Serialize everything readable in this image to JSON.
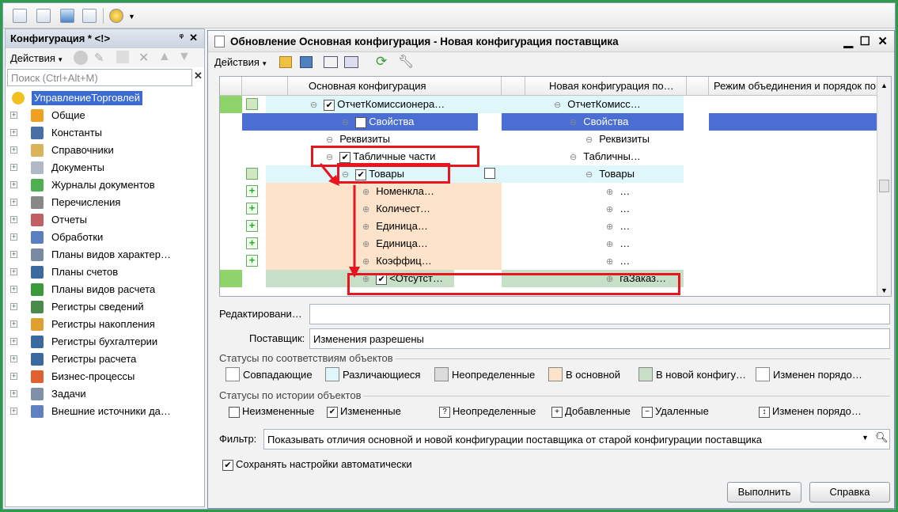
{
  "panel": {
    "title": "Конфигурация * <!>",
    "actions": "Действия",
    "search_placeholder": "Поиск (Ctrl+Alt+M)",
    "tree": [
      {
        "label": "УправлениеТорговлей",
        "icon": "config-icon",
        "selected": true,
        "color": "#f0c020"
      },
      {
        "label": "Общие",
        "icon": "common-icon",
        "color": "#f0a020"
      },
      {
        "label": "Константы",
        "icon": "constants-icon",
        "color": "#4a6fa5"
      },
      {
        "label": "Справочники",
        "icon": "catalogs-icon",
        "color": "#d9b45a"
      },
      {
        "label": "Документы",
        "icon": "documents-icon",
        "color": "#b0b8c4"
      },
      {
        "label": "Журналы документов",
        "icon": "journals-icon",
        "color": "#4caf50"
      },
      {
        "label": "Перечисления",
        "icon": "enums-icon",
        "color": "#888888"
      },
      {
        "label": "Отчеты",
        "icon": "reports-icon",
        "color": "#c06060"
      },
      {
        "label": "Обработки",
        "icon": "processing-icon",
        "color": "#5a7fc0"
      },
      {
        "label": "Планы видов характер…",
        "icon": "chart-types-icon",
        "color": "#7a8aa0"
      },
      {
        "label": "Планы счетов",
        "icon": "accounts-icon",
        "color": "#3a6aa0"
      },
      {
        "label": "Планы видов расчета",
        "icon": "calc-types-icon",
        "color": "#3a9a3a"
      },
      {
        "label": "Регистры сведений",
        "icon": "info-reg-icon",
        "color": "#4a8a4a"
      },
      {
        "label": "Регистры накопления",
        "icon": "accum-reg-icon",
        "color": "#e0a030"
      },
      {
        "label": "Регистры бухгалтерии",
        "icon": "acc-reg-icon",
        "color": "#3a6aa0"
      },
      {
        "label": "Регистры расчета",
        "icon": "calc-reg-icon",
        "color": "#3a6aa0"
      },
      {
        "label": "Бизнес-процессы",
        "icon": "bp-icon",
        "color": "#e06030"
      },
      {
        "label": "Задачи",
        "icon": "tasks-icon",
        "color": "#8090a8"
      },
      {
        "label": "Внешние источники да…",
        "icon": "ext-icon",
        "color": "#6080c0"
      }
    ]
  },
  "window": {
    "title": "Обновление Основная конфигурация - Новая конфигурация поставщика",
    "actions": "Действия",
    "columns": [
      "Основная конфигурация",
      "Новая конфигурация по…",
      "Режим объединения и порядок по…"
    ],
    "rows": [
      {
        "left": "ОтчетКомиссионера…",
        "right": "ОтчетКомисс…",
        "bg": "#dff7fb"
      },
      {
        "left": "Свойства",
        "right": "Свойства",
        "bg": "#4a6ed4",
        "sel": true
      },
      {
        "left": "Реквизиты",
        "right": "Реквизиты",
        "bg": "#ffffff"
      },
      {
        "left": "Табличные части",
        "right": "Табличны…",
        "bg": "#ffffff"
      },
      {
        "left": "Товары",
        "right": "Товары",
        "bg": "#dff7fb"
      },
      {
        "left": "Номенкла…",
        "right": "…",
        "bg": "#fde3c9"
      },
      {
        "left": "Количест…",
        "right": "…",
        "bg": "#fde3c9"
      },
      {
        "left": "Единица…",
        "right": "…",
        "bg": "#fde3c9"
      },
      {
        "left": "Единица…",
        "right": "…",
        "bg": "#fde3c9"
      },
      {
        "left": "Коэффиц…",
        "right": "…",
        "bg": "#fde3c9"
      },
      {
        "left": "<Отсутст…",
        "right": "гаЗаказ…",
        "bg": "#c7dfc7"
      }
    ],
    "editing_label": "Редактировани…",
    "editing_value": "",
    "supplier_label": "Поставщик:",
    "supplier_value": "Изменения разрешены",
    "status_match_title": "Статусы по соответствиям объектов",
    "status_match": [
      {
        "label": "Совпадающие",
        "color": "#ffffff"
      },
      {
        "label": "Различающиеся",
        "color": "#dff7fb"
      },
      {
        "label": "Неопределенные",
        "color": "#dcdcdc"
      },
      {
        "label": "В основной",
        "color": "#fde3c9"
      },
      {
        "label": "В новой конфигу…",
        "color": "#c7dfc7"
      },
      {
        "label": "Изменен порядо…",
        "color": "#ffffff"
      }
    ],
    "status_hist_title": "Статусы по истории объектов",
    "status_hist": [
      "Неизмененные",
      "Измененные",
      "Неопределенные",
      "Добавленные",
      "Удаленные",
      "Изменен порядо…"
    ],
    "filter_label": "Фильтр:",
    "filter_value": "Показывать отличия основной и новой конфигурации поставщика от старой конфигурации поставщика",
    "save_label": "Сохранять настройки автоматически",
    "run_label": "Выполнить",
    "help_label": "Справка"
  }
}
